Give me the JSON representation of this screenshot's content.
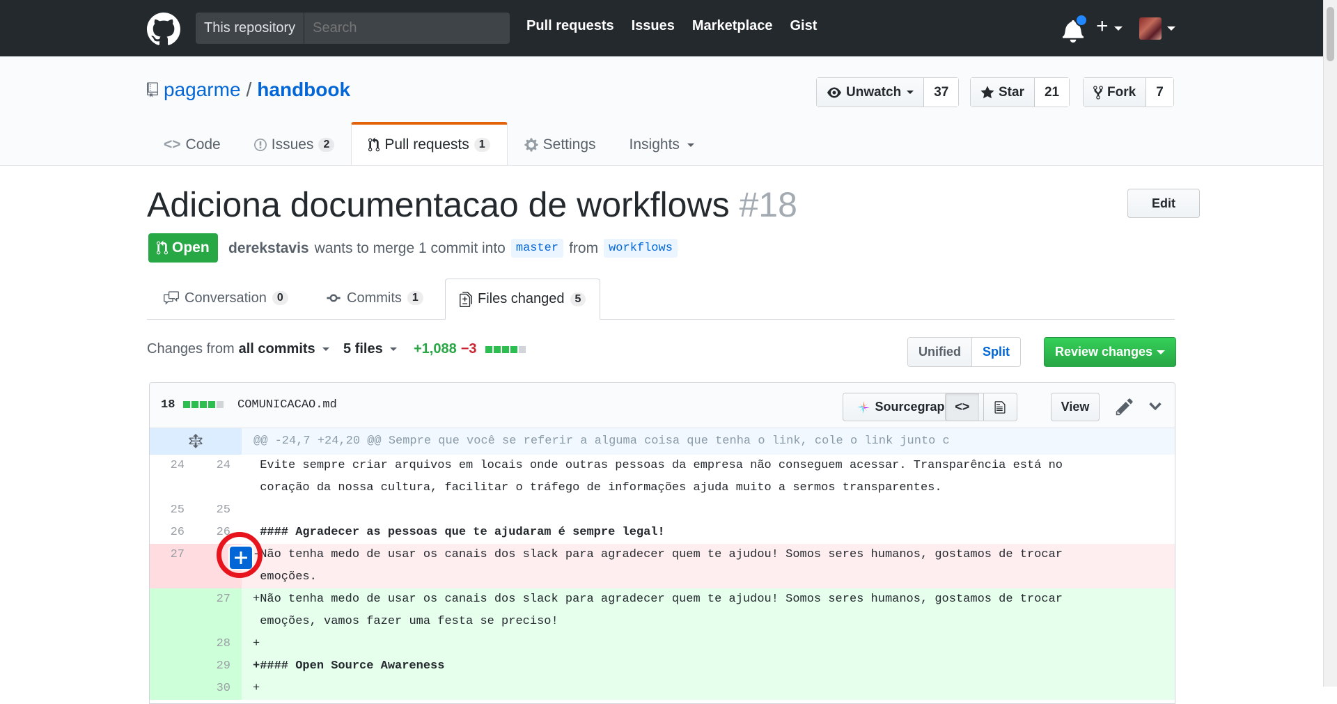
{
  "header": {
    "search_scope": "This repository",
    "search_placeholder": "Search",
    "nav": [
      "Pull requests",
      "Issues",
      "Marketplace",
      "Gist"
    ]
  },
  "repo": {
    "owner": "pagarme",
    "separator": "/",
    "name": "handbook",
    "actions": {
      "watch_label": "Unwatch",
      "watch_count": "37",
      "star_label": "Star",
      "star_count": "21",
      "fork_label": "Fork",
      "fork_count": "7"
    },
    "tabs": [
      {
        "label": "Code",
        "count": ""
      },
      {
        "label": "Issues",
        "count": "2"
      },
      {
        "label": "Pull requests",
        "count": "1"
      },
      {
        "label": "Settings",
        "count": ""
      },
      {
        "label": "Insights",
        "count": ""
      }
    ]
  },
  "pr": {
    "title": "Adiciona documentacao de workflows",
    "number": "#18",
    "edit_label": "Edit",
    "state": "Open",
    "author": "derekstavis",
    "merge_text": "wants to merge 1 commit into",
    "base_branch": "master",
    "from_text": "from",
    "head_branch": "workflows",
    "tabs": [
      {
        "label": "Conversation",
        "count": "0"
      },
      {
        "label": "Commits",
        "count": "1"
      },
      {
        "label": "Files changed",
        "count": "5"
      }
    ]
  },
  "toolbar": {
    "changes_from": "Changes from",
    "all_commits": "all commits",
    "files": "5 files",
    "additions": "+1,088",
    "deletions": "−3",
    "view_unified": "Unified",
    "view_split": "Split",
    "review_changes": "Review changes"
  },
  "file": {
    "change_count": "18",
    "filename": "COMUNICACAO.md",
    "sourcegraph_label": "Sourcegraph",
    "view_label": "View",
    "hunk_header": "@@ -24,7 +24,20 @@ Sempre que você se referir a alguma coisa que tenha o link, cole o link junto c",
    "lines": [
      {
        "type": "ctx",
        "old": "24",
        "new": "24",
        "text": " Evite sempre criar arquivos em locais onde outras pessoas da empresa não conseguem acessar. Transparência está no\n coração da nossa cultura, facilitar o tráfego de informações ajuda muito a sermos transparentes."
      },
      {
        "type": "ctx",
        "old": "25",
        "new": "25",
        "text": " "
      },
      {
        "type": "ctx",
        "old": "26",
        "new": "26",
        "text": " #### Agradecer as pessoas que te ajudaram é sempre legal!"
      },
      {
        "type": "del",
        "old": "27",
        "new": "",
        "text": "-Não tenha medo de usar os canais dos slack para agradecer quem te ajudou! Somos seres humanos, gostamos de trocar\n emoções."
      },
      {
        "type": "add",
        "old": "",
        "new": "27",
        "text": "+Não tenha medo de usar os canais dos slack para agradecer quem te ajudou! Somos seres humanos, gostamos de trocar\n emoções, vamos fazer uma festa se preciso!"
      },
      {
        "type": "add",
        "old": "",
        "new": "28",
        "text": "+"
      },
      {
        "type": "add",
        "old": "",
        "new": "29",
        "text": "+#### Open Source Awareness"
      },
      {
        "type": "add",
        "old": "",
        "new": "30",
        "text": "+"
      }
    ]
  },
  "colors": {
    "header_bg": "#24292e",
    "link": "#0366d6",
    "open_green": "#28a745",
    "addition_bg": "#e6ffed",
    "deletion_bg": "#ffeef0",
    "tab_accent": "#e36209",
    "highlight_ring": "#e8141d"
  }
}
